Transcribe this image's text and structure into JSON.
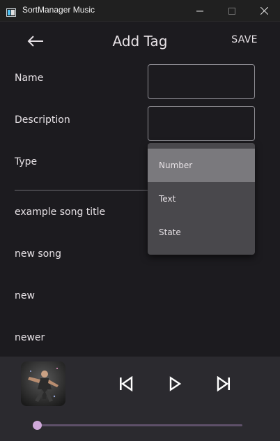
{
  "window": {
    "title": "SortManager Music"
  },
  "appbar": {
    "title": "Add Tag",
    "save_label": "SAVE"
  },
  "form": {
    "name_label": "Name",
    "name_value": "",
    "description_label": "Description",
    "description_value": "",
    "type_label": "Type"
  },
  "type_dropdown": {
    "options": [
      "Number",
      "Text",
      "State"
    ],
    "highlighted": "Number"
  },
  "songs": [
    "example song title",
    "new song",
    "new",
    "newer"
  ],
  "player": {
    "progress": 0.0,
    "accent_color": "#cfa8d9"
  }
}
